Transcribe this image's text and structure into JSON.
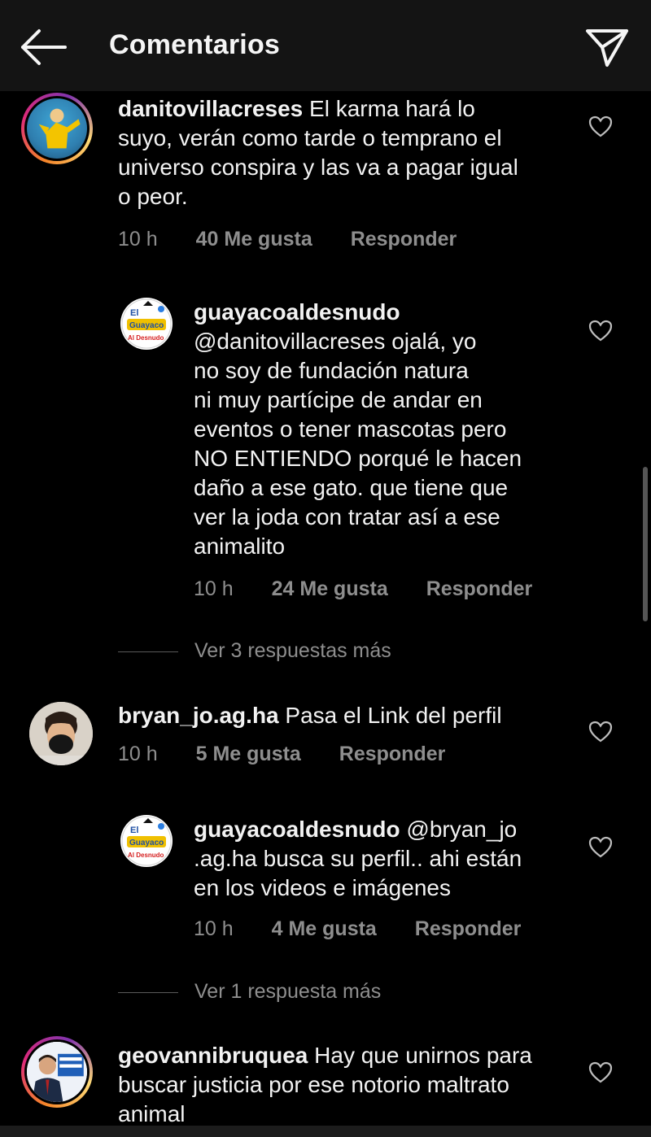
{
  "header": {
    "title": "Comentarios",
    "back_icon": "arrow-left-icon",
    "share_icon": "paper-plane-icon"
  },
  "comments": [
    {
      "username": "danitovillacreses",
      "lines": [
        "El karma hará lo",
        "suyo, verán como tarde o temprano el",
        "universo conspira y las va a pagar igual",
        "o peor."
      ],
      "time": "10 h",
      "likes": "40 Me gusta",
      "reply": "Responder"
    },
    {
      "username": "guayacoaldesnudo",
      "lines": [
        "@danitovillacreses ojalá, yo",
        "no soy de fundación natura",
        "ni muy partícipe de andar en",
        "eventos o tener mascotas pero",
        "NO ENTIENDO porqué le hacen",
        "daño a ese gato. que tiene que",
        "ver la joda con tratar así a ese",
        "animalito"
      ],
      "time": "10 h",
      "likes": "24 Me gusta",
      "reply": "Responder"
    },
    {
      "username": "bryan_jo.ag.ha",
      "lines": [
        "Pasa el Link del perfil"
      ],
      "time": "10 h",
      "likes": "5 Me gusta",
      "reply": "Responder"
    },
    {
      "username": "guayacoaldesnudo",
      "lines": [
        "@bryan_jo",
        ".ag.ha busca su perfil.. ahi están",
        "en los videos e imágenes"
      ],
      "time": "10 h",
      "likes": "4 Me gusta",
      "reply": "Responder"
    },
    {
      "username": "geovannibruquea",
      "lines": [
        "Hay que unirnos para",
        "buscar justicia por ese notorio maltrato",
        "animal"
      ]
    }
  ],
  "view_more": [
    "Ver 3 respuestas más",
    "Ver 1 respuesta más"
  ],
  "logo_text": {
    "top": "El",
    "middle": "Guayaco",
    "bottom": "Al Desnudo"
  },
  "colors": {
    "background": "#000000",
    "header": "#141414",
    "meta": "#8e8e8e",
    "text": "#f2f2f2"
  }
}
